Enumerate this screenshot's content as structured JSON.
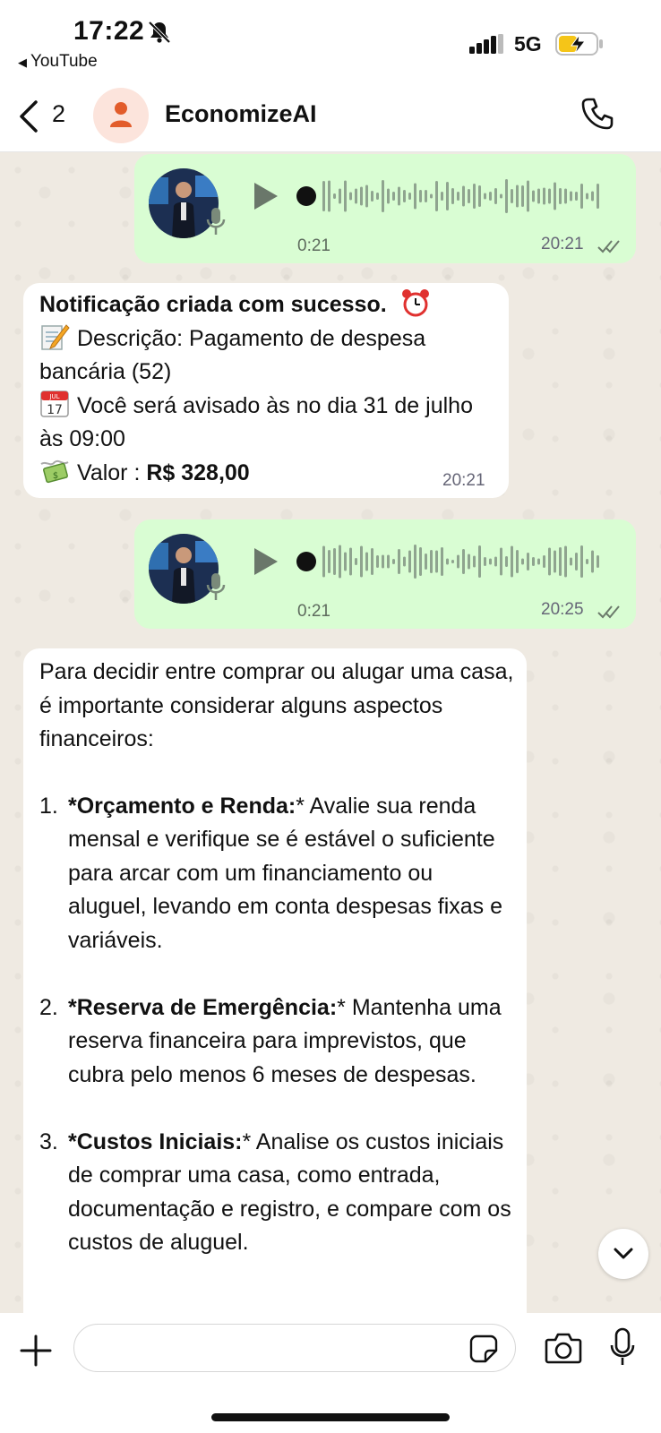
{
  "status_bar": {
    "time": "17:22",
    "back_app": "YouTube",
    "network": "5G"
  },
  "header": {
    "back_count": "2",
    "contact_name": "EconomizeAI"
  },
  "messages": [
    {
      "type": "voice",
      "direction": "outgoing",
      "duration": "0:21",
      "time": "20:21",
      "status": "read"
    },
    {
      "type": "text",
      "direction": "incoming",
      "time": "20:21",
      "title": "Notificação criada com sucesso.",
      "description": "Descrição: Pagamento de despesa bancária (52)",
      "reminder": "Você será avisado às no dia 31 de julho às 09:00",
      "value_label": "Valor : ",
      "value": "R$ 328,00"
    },
    {
      "type": "voice",
      "direction": "outgoing",
      "duration": "0:21",
      "time": "20:25",
      "status": "read"
    },
    {
      "type": "text",
      "direction": "incoming",
      "intro": "Para decidir entre comprar ou alugar uma casa, é importante considerar alguns aspectos financeiros:",
      "items": [
        {
          "num": "1.",
          "title": "*Orçamento e Renda:",
          "text": "* Avalie sua renda mensal e verifique se é estável o suficiente para arcar com um financiamento ou aluguel, levando em conta despesas fixas e variáveis."
        },
        {
          "num": "2.",
          "title": "*Reserva de Emergência:",
          "text": "* Mantenha uma reserva financeira para imprevistos, que cubra pelo menos 6 meses de despesas."
        },
        {
          "num": "3.",
          "title": "*Custos Iniciais:",
          "text": "* Analise os custos iniciais de comprar uma casa, como entrada, documentação e registro, e compare com os custos de aluguel."
        }
      ]
    }
  ],
  "input": {
    "placeholder": "",
    "value": ""
  },
  "icons": {
    "alarm": "alarm-clock-icon",
    "memo": "memo-icon",
    "calendar": "calendar-icon",
    "money": "money-wings-icon",
    "calendar_day": "17",
    "calendar_month": "JUL"
  },
  "colors": {
    "outgoing_bubble": "#d9fdd3",
    "incoming_bubble": "#ffffff",
    "background": "#efeae2",
    "tick_read": "#53bdeb",
    "avatar_icon": "#e25c2b"
  }
}
